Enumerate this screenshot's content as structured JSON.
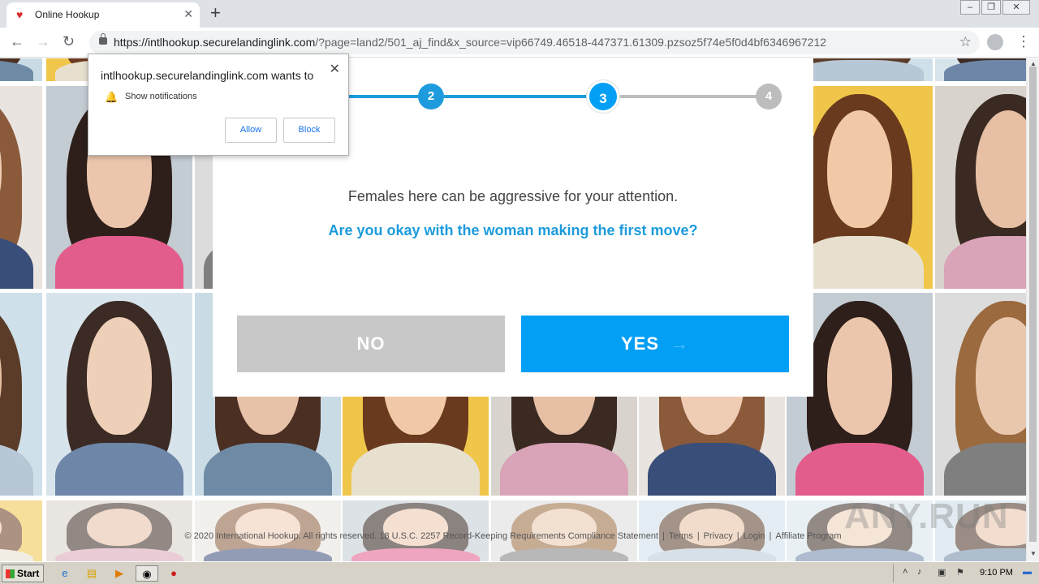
{
  "browser": {
    "tab_title": "Online Hookup",
    "tab_favicon": "heart-icon",
    "url_host": "https://intlhookup.securelandinglink.com",
    "url_rest": "/?page=land2/501_aj_find&x_source=vip66749.46518-447371.61309.pzsoz5f74e5f0d4bf6346967212"
  },
  "notification": {
    "title": "intlhookup.securelandinglink.com wants to",
    "line": "Show notifications",
    "allow": "Allow",
    "block": "Block"
  },
  "modal": {
    "steps": [
      "2",
      "3",
      "4"
    ],
    "active_step": 3,
    "statement": "Females here can be aggressive for your attention.",
    "question": "Are you okay with the woman making the first move?",
    "no_label": "NO",
    "yes_label": "YES",
    "colors": {
      "accent": "#039ff5",
      "done": "#1d9bdc",
      "pending": "#bdbdbd",
      "no_btn": "#c8c8c8"
    }
  },
  "footer": {
    "copyright": "© 2020 International Hookup. All rights reserved. 18 U.S.C. 2257 Record-Keeping Requirements Compliance Statement",
    "terms": "Terms",
    "privacy": "Privacy",
    "login": "Login",
    "affiliate": "Affiliate Program",
    "sep": "|"
  },
  "watermark": "ANY.RUN",
  "taskbar": {
    "start": "Start",
    "clock": "9:10 PM"
  }
}
